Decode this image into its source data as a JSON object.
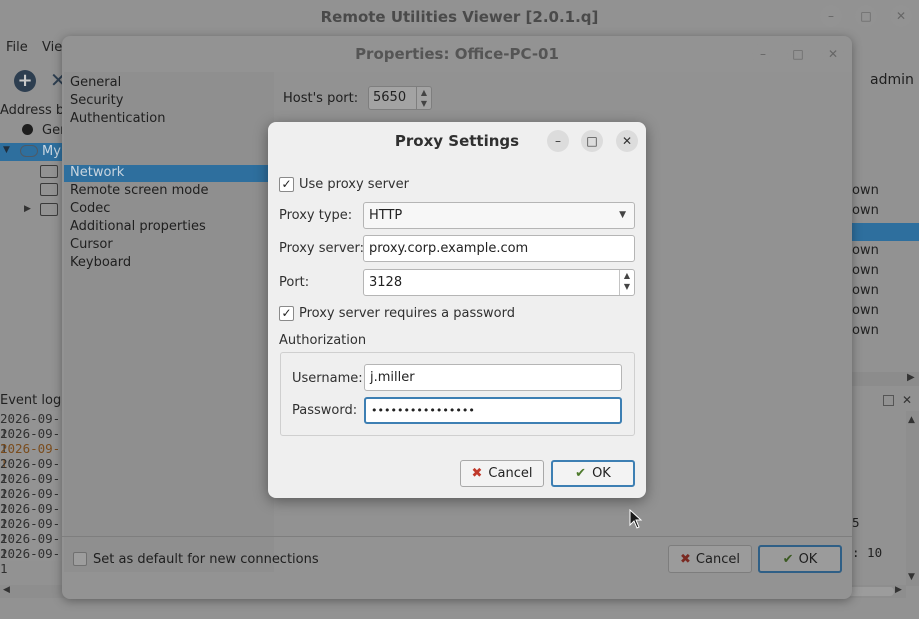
{
  "main": {
    "title": "Remote Utilities Viewer [2.0.1.q]",
    "menu": [
      "File",
      "View"
    ],
    "user": "admin",
    "address_book_label": "Address bo",
    "tree": [
      "Ger",
      "My"
    ],
    "right_status": [
      "own",
      "own",
      "own",
      "own",
      "own",
      "own",
      "own"
    ],
    "event_log_title": "Event log",
    "event_log_rows": [
      "2026-09-1",
      "2026-09-1",
      "2026-09-1",
      "2026-09-1",
      "2026-09-1",
      "2026-09-1",
      "2026-09-1",
      "2026-09-1",
      "2026-09-1",
      "2026-09-1"
    ],
    "right_fragments": [
      "5",
      ": 10"
    ]
  },
  "properties": {
    "title": "Properties: Office-PC-01",
    "sections": [
      "General",
      "Security",
      "Authentication",
      "Network",
      "Remote screen mode",
      "Codec",
      "Additional properties",
      "Cursor",
      "Keyboard"
    ],
    "selected_section": "Network",
    "host_port_label": "Host's port:",
    "host_port_value": "5650",
    "default_checkbox_label": "Set as default for new connections",
    "cancel_label": "Cancel",
    "ok_label": "OK"
  },
  "proxy": {
    "title": "Proxy Settings",
    "use_proxy_label": "Use proxy server",
    "use_proxy_checked": true,
    "proxy_type_label": "Proxy type:",
    "proxy_type_value": "HTTP",
    "proxy_server_label": "Proxy server:",
    "proxy_server_value": "proxy.corp.example.com",
    "port_label": "Port:",
    "port_value": "3128",
    "requires_password_label": "Proxy server requires a password",
    "requires_password_checked": true,
    "authorization_label": "Authorization",
    "username_label": "Username:",
    "username_value": "j.miller",
    "password_label": "Password:",
    "password_value": "••••••••••••••••",
    "cancel_label": "Cancel",
    "ok_label": "OK"
  },
  "colors": {
    "accent": "#3d7fb3",
    "selection": "#2e6f9e",
    "cancel_icon": "#c0392b",
    "ok_icon": "#4e7a2c",
    "log_highlight": "#b5651d"
  }
}
